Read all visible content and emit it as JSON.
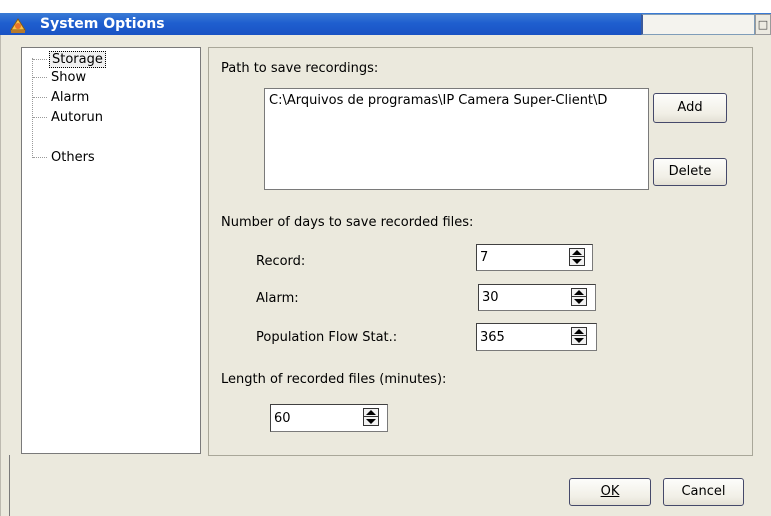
{
  "window": {
    "title": "System Options",
    "title_button_icon": "restore-icon",
    "colors": {
      "titlebar": "#1f5fcf",
      "body": "#ebe9dd"
    }
  },
  "tree": {
    "items": [
      {
        "label": "Storage",
        "selected": true
      },
      {
        "label": "Show",
        "selected": false
      },
      {
        "label": "Alarm",
        "selected": false
      },
      {
        "label": "Autorun",
        "selected": false
      },
      {
        "label": "Others",
        "selected": false
      }
    ]
  },
  "storage": {
    "path_label": "Path to save recordings:",
    "paths": [
      "C:\\Arquivos de programas\\IP Camera Super-Client\\D"
    ],
    "add_label": "Add",
    "delete_label": "Delete",
    "days_label": "Number of days to save recorded files:",
    "record_label": "Record:",
    "record_value": "7",
    "alarm_label": "Alarm:",
    "alarm_value": "30",
    "population_label": "Population Flow Stat.:",
    "population_value": "365",
    "length_label": "Length of recorded files (minutes):",
    "length_value": "60"
  },
  "footer": {
    "ok_label": "OK",
    "cancel_label": "Cancel"
  }
}
